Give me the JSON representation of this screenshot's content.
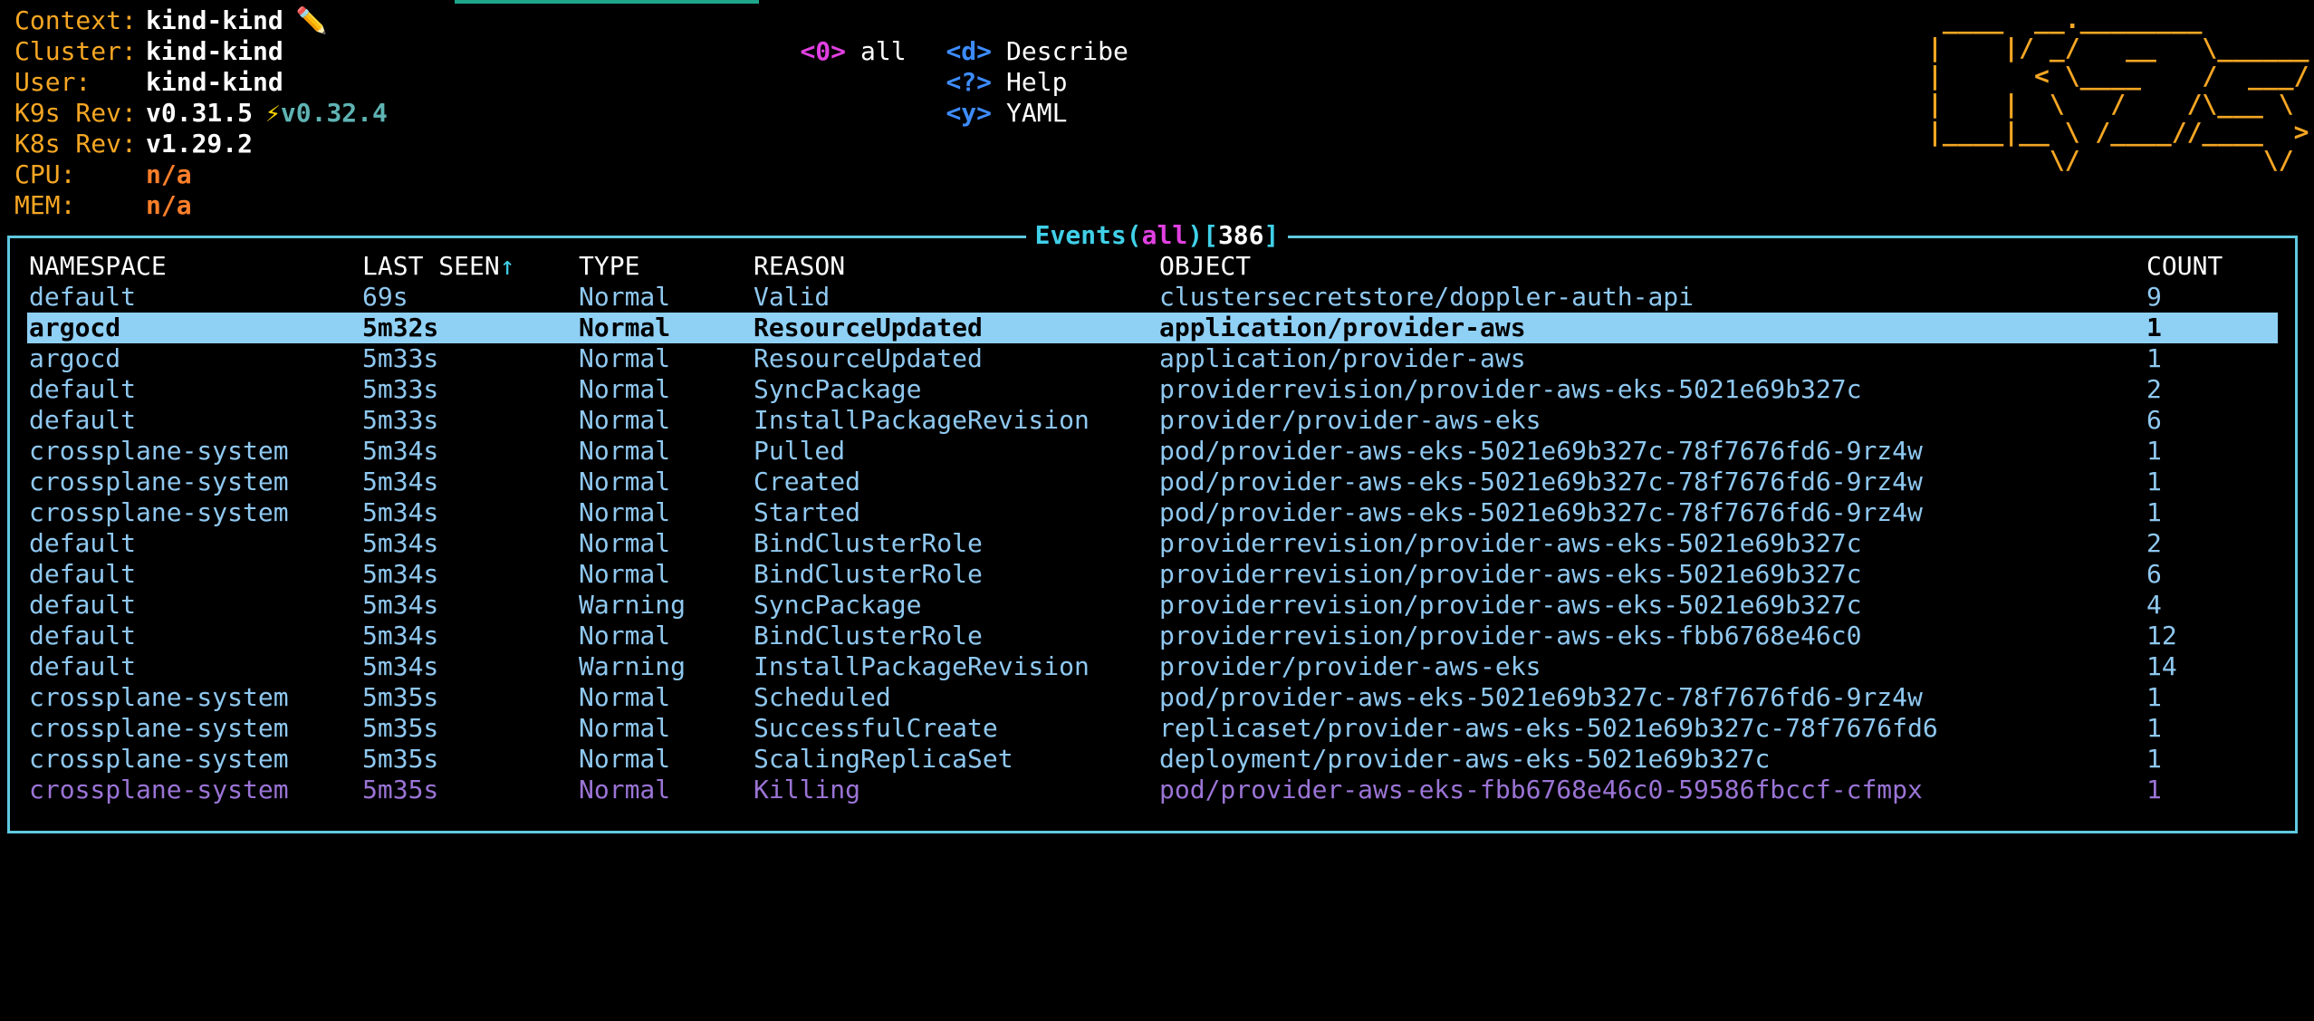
{
  "info": {
    "context_label": "Context:",
    "context_value": "kind-kind",
    "context_edit_glyph": "✏️",
    "cluster_label": "Cluster:",
    "cluster_value": "kind-kind",
    "user_label": "User:",
    "user_value": "kind-kind",
    "k9s_rev_label": "K9s Rev:",
    "k9s_rev_value": "v0.31.5",
    "k9s_upgrade_glyph": "⚡",
    "k9s_upgrade_value": "v0.32.4",
    "k8s_rev_label": "K8s Rev:",
    "k8s_rev_value": "v1.29.2",
    "cpu_label": "CPU:",
    "cpu_value": "n/a",
    "mem_label": "MEM:",
    "mem_value": "n/a"
  },
  "namespace_menu": [
    {
      "key": "<0>",
      "label": "all"
    }
  ],
  "command_menu": [
    {
      "key": "<d>",
      "label": "Describe"
    },
    {
      "key": "<?>",
      "label": "Help"
    },
    {
      "key": "<y>",
      "label": "YAML"
    }
  ],
  "logo_ascii": " ____  __.________       \n|    |/ _/   __   \\______\n|      < \\____    /  ___/\n|    |  \\   /    /\\___ \\ \n|____|__ \\ /____//____  >\n        \\/            \\/ ",
  "view": {
    "name": "Events",
    "open_paren": "(",
    "filter": "all",
    "close_paren": ")",
    "open_bracket": "[",
    "count": "386",
    "close_bracket": "]"
  },
  "table": {
    "headers": {
      "namespace": "NAMESPACE",
      "last_seen": "LAST SEEN",
      "sort_indicator": "↑",
      "type": "TYPE",
      "reason": "REASON",
      "object": "OBJECT",
      "count": "COUNT"
    },
    "rows": [
      {
        "namespace": "default",
        "last_seen": "69s",
        "type": "Normal",
        "reason": "Valid",
        "object": "clustersecretstore/doppler-auth-api",
        "count": "9"
      },
      {
        "namespace": "argocd",
        "last_seen": "5m32s",
        "type": "Normal",
        "reason": "ResourceUpdated",
        "object": "application/provider-aws",
        "count": "1"
      },
      {
        "namespace": "argocd",
        "last_seen": "5m33s",
        "type": "Normal",
        "reason": "ResourceUpdated",
        "object": "application/provider-aws",
        "count": "1"
      },
      {
        "namespace": "default",
        "last_seen": "5m33s",
        "type": "Normal",
        "reason": "SyncPackage",
        "object": "providerrevision/provider-aws-eks-5021e69b327c",
        "count": "2"
      },
      {
        "namespace": "default",
        "last_seen": "5m33s",
        "type": "Normal",
        "reason": "InstallPackageRevision",
        "object": "provider/provider-aws-eks",
        "count": "6"
      },
      {
        "namespace": "crossplane-system",
        "last_seen": "5m34s",
        "type": "Normal",
        "reason": "Pulled",
        "object": "pod/provider-aws-eks-5021e69b327c-78f7676fd6-9rz4w",
        "count": "1"
      },
      {
        "namespace": "crossplane-system",
        "last_seen": "5m34s",
        "type": "Normal",
        "reason": "Created",
        "object": "pod/provider-aws-eks-5021e69b327c-78f7676fd6-9rz4w",
        "count": "1"
      },
      {
        "namespace": "crossplane-system",
        "last_seen": "5m34s",
        "type": "Normal",
        "reason": "Started",
        "object": "pod/provider-aws-eks-5021e69b327c-78f7676fd6-9rz4w",
        "count": "1"
      },
      {
        "namespace": "default",
        "last_seen": "5m34s",
        "type": "Normal",
        "reason": "BindClusterRole",
        "object": "providerrevision/provider-aws-eks-5021e69b327c",
        "count": "2"
      },
      {
        "namespace": "default",
        "last_seen": "5m34s",
        "type": "Normal",
        "reason": "BindClusterRole",
        "object": "providerrevision/provider-aws-eks-5021e69b327c",
        "count": "6"
      },
      {
        "namespace": "default",
        "last_seen": "5m34s",
        "type": "Warning",
        "reason": "SyncPackage",
        "object": "providerrevision/provider-aws-eks-5021e69b327c",
        "count": "4"
      },
      {
        "namespace": "default",
        "last_seen": "5m34s",
        "type": "Normal",
        "reason": "BindClusterRole",
        "object": "providerrevision/provider-aws-eks-fbb6768e46c0",
        "count": "12"
      },
      {
        "namespace": "default",
        "last_seen": "5m34s",
        "type": "Warning",
        "reason": "InstallPackageRevision",
        "object": "provider/provider-aws-eks",
        "count": "14"
      },
      {
        "namespace": "crossplane-system",
        "last_seen": "5m35s",
        "type": "Normal",
        "reason": "Scheduled",
        "object": "pod/provider-aws-eks-5021e69b327c-78f7676fd6-9rz4w",
        "count": "1"
      },
      {
        "namespace": "crossplane-system",
        "last_seen": "5m35s",
        "type": "Normal",
        "reason": "SuccessfulCreate",
        "object": "replicaset/provider-aws-eks-5021e69b327c-78f7676fd6",
        "count": "1"
      },
      {
        "namespace": "crossplane-system",
        "last_seen": "5m35s",
        "type": "Normal",
        "reason": "ScalingReplicaSet",
        "object": "deployment/provider-aws-eks-5021e69b327c",
        "count": "1"
      },
      {
        "namespace": "crossplane-system",
        "last_seen": "5m35s",
        "type": "Normal",
        "reason": "Killing",
        "object": "pod/provider-aws-eks-fbb6768e46c0-59586fbccf-cfmpx",
        "count": "1"
      }
    ]
  },
  "colors": {
    "label": "#f5a623",
    "value": "#ffffff",
    "na_value": "#ff7f2a",
    "upgrade": "#5fb3b3",
    "ns_key": "#e040e0",
    "cmd_key": "#3d8cff",
    "frame": "#5fc9e0",
    "row_text": "#8fc8f0",
    "selected_bg": "#8fd0f5",
    "dim_row": "#9b74d6"
  }
}
